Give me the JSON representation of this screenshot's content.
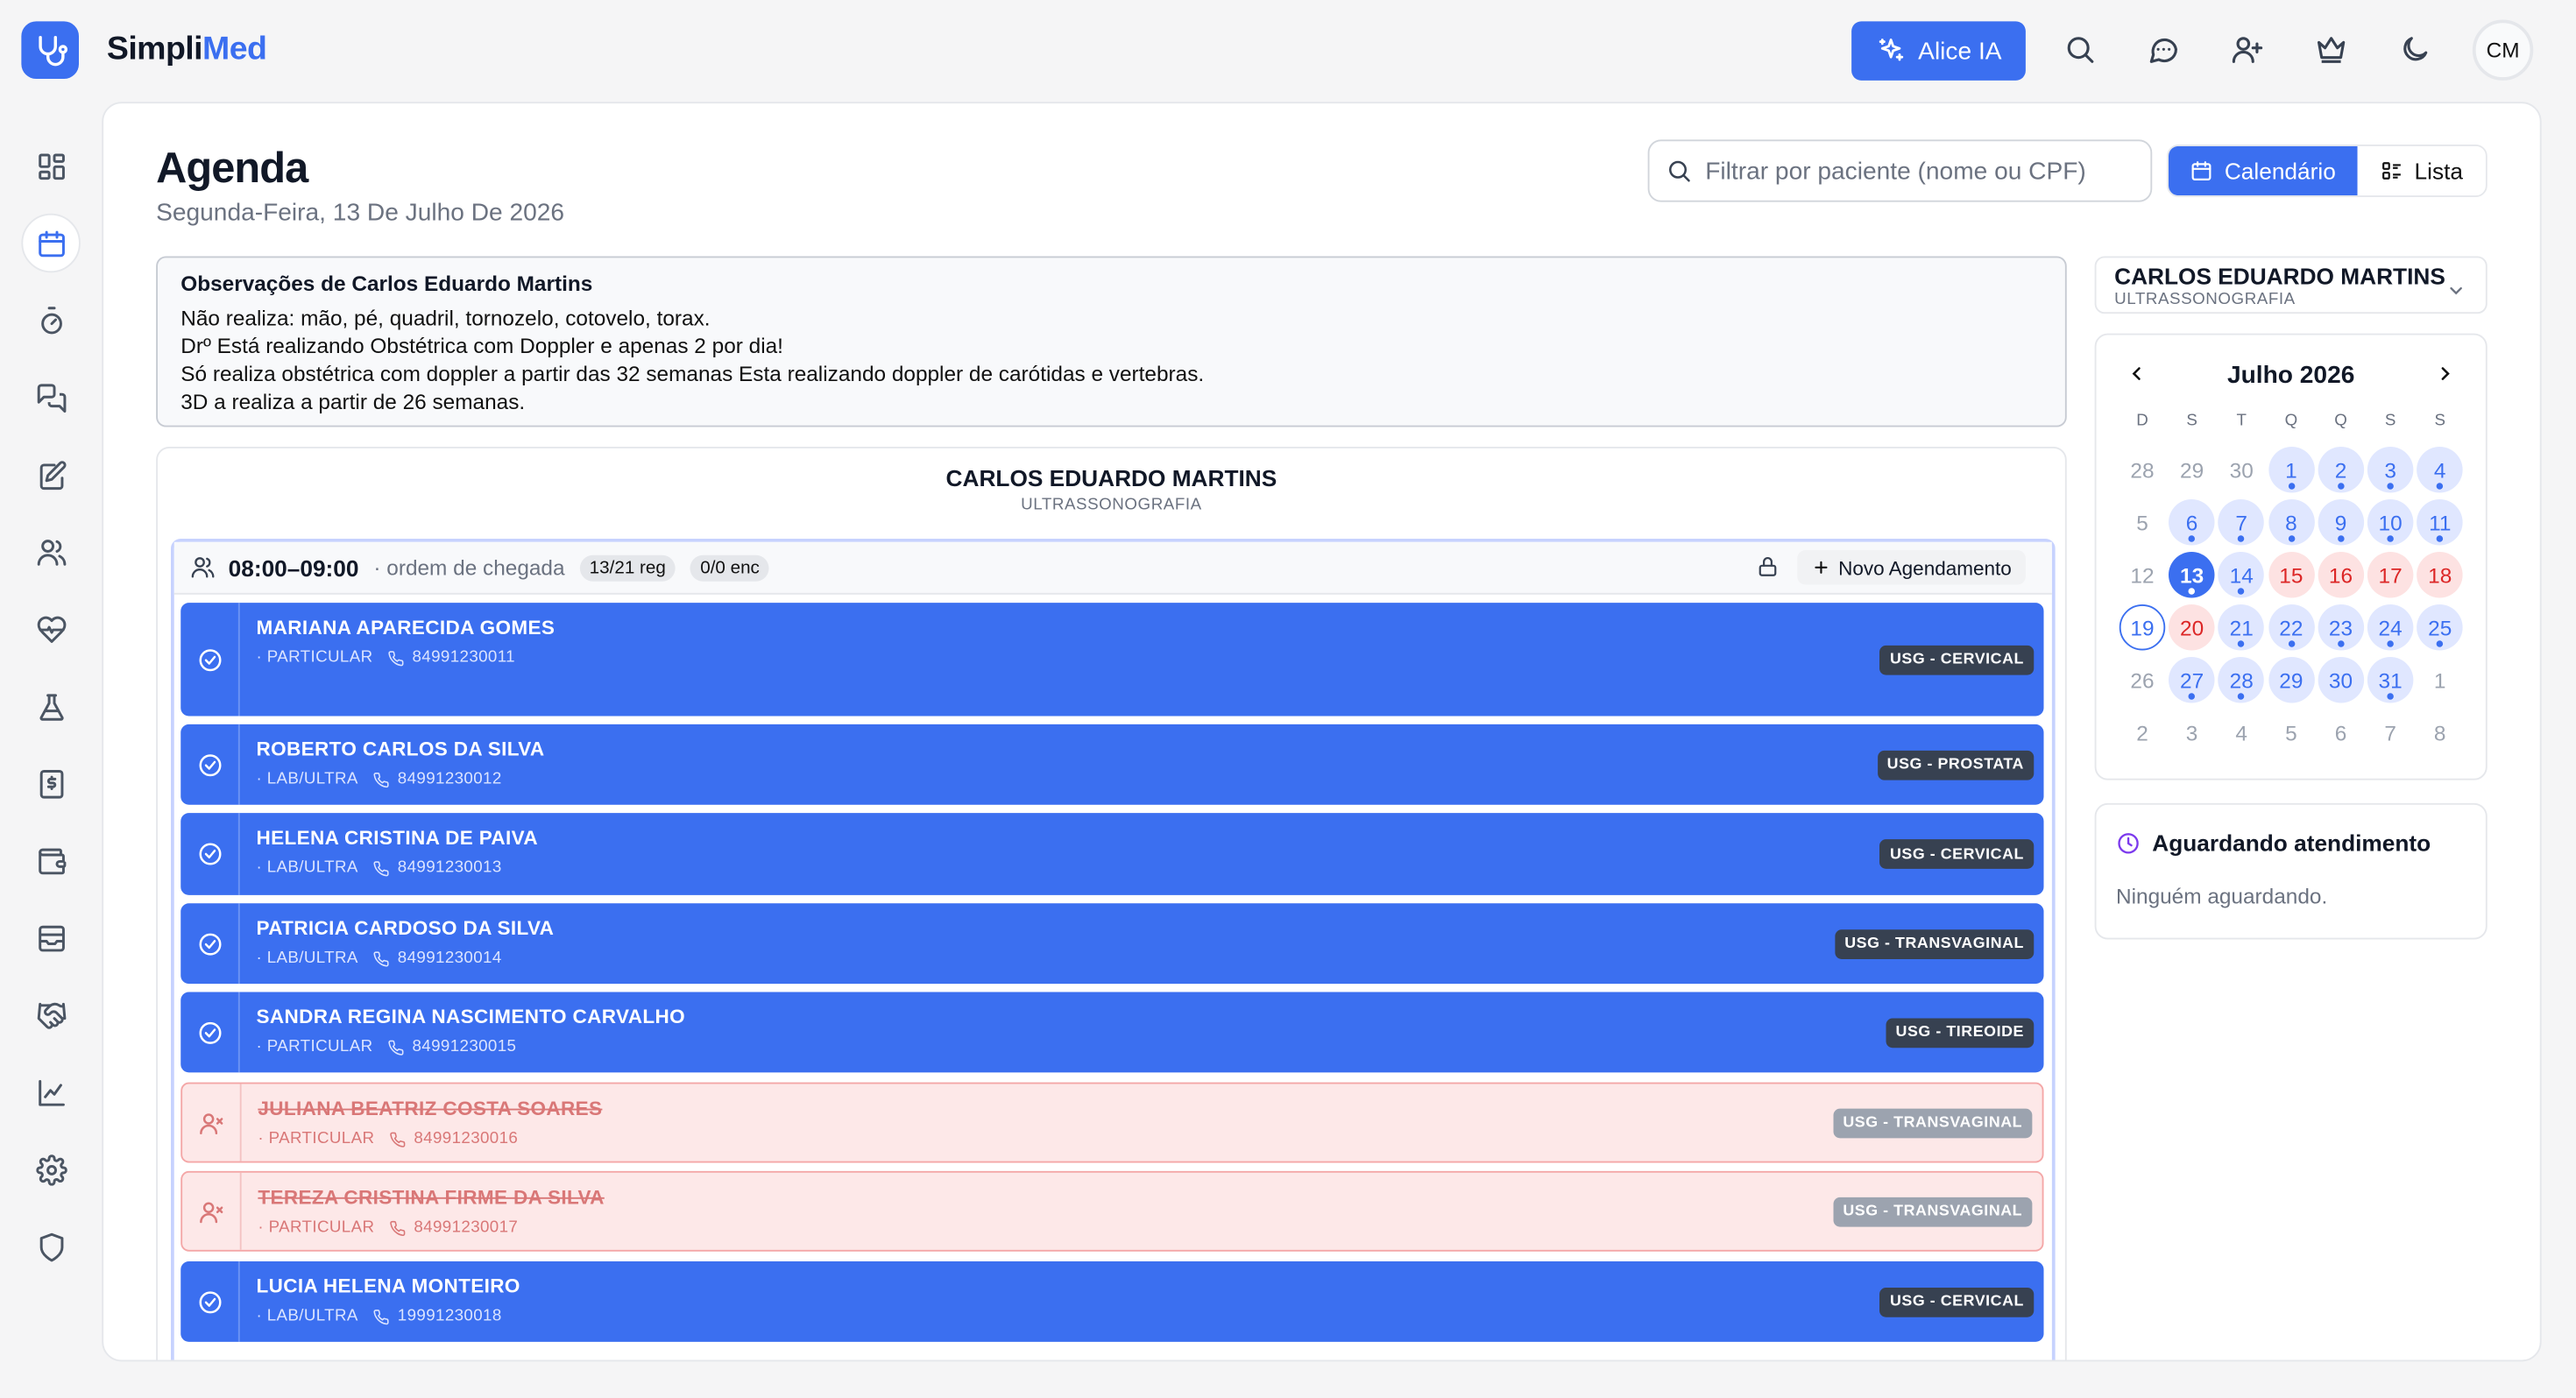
{
  "brand": {
    "name_a": "Simpli",
    "name_b": "Med",
    "accent": "#3b6ff0"
  },
  "topbar": {
    "alice_label": "Alice IA",
    "avatar_initials": "CM"
  },
  "page": {
    "title": "Agenda",
    "subtitle": "Segunda-Feira, 13 De Julho De 2026"
  },
  "filter": {
    "placeholder": "Filtrar por paciente (nome ou CPF)"
  },
  "view_toggle": {
    "calendar_label": "Calendário",
    "list_label": "Lista"
  },
  "observations": {
    "title": "Observações de Carlos Eduardo Martins",
    "lines": [
      "Não realiza: mão, pé, quadril, tornozelo, cotovelo, torax.",
      "Drº Está realizando Obstétrica com Doppler e apenas 2 por dia!",
      "Só realiza obstétrica com doppler a partir das 32 semanas Esta realizando doppler de carótidas e vertebras.",
      "3D a realiza a partir de 26 semanas."
    ]
  },
  "schedule": {
    "doctor": "CARLOS EDUARDO MARTINS",
    "specialty": "ULTRASSONOGRAFIA",
    "slot_time": "08:00–09:00",
    "slot_mode": "· ordem de chegada",
    "chip_reg": "13/21 reg",
    "chip_enc": "0/0 enc",
    "new_button": "Novo Agendamento",
    "appointments": [
      {
        "name": "MARIANA APARECIDA GOMES",
        "insurance": "· PARTICULAR",
        "phone": "84991230011",
        "exam": "USG - CERVICAL",
        "status": "confirmed"
      },
      {
        "name": "ROBERTO CARLOS DA SILVA",
        "insurance": "· LAB/ULTRA",
        "phone": "84991230012",
        "exam": "USG - PROSTATA",
        "status": "confirmed"
      },
      {
        "name": "HELENA CRISTINA DE PAIVA",
        "insurance": "· LAB/ULTRA",
        "phone": "84991230013",
        "exam": "USG - CERVICAL",
        "status": "confirmed"
      },
      {
        "name": "PATRICIA CARDOSO DA SILVA",
        "insurance": "· LAB/ULTRA",
        "phone": "84991230014",
        "exam": "USG - TRANSVAGINAL",
        "status": "confirmed"
      },
      {
        "name": "SANDRA REGINA NASCIMENTO CARVALHO",
        "insurance": "· PARTICULAR",
        "phone": "84991230015",
        "exam": "USG - TIREOIDE",
        "status": "confirmed"
      },
      {
        "name": "JULIANA BEATRIZ COSTA SOARES",
        "insurance": "· PARTICULAR",
        "phone": "84991230016",
        "exam": "USG - TRANSVAGINAL",
        "status": "cancelled"
      },
      {
        "name": "TEREZA CRISTINA FIRME DA SILVA",
        "insurance": "· PARTICULAR",
        "phone": "84991230017",
        "exam": "USG - TRANSVAGINAL",
        "status": "cancelled"
      },
      {
        "name": "LUCIA HELENA MONTEIRO",
        "insurance": "· LAB/ULTRA",
        "phone": "19991230018",
        "exam": "USG - CERVICAL",
        "status": "confirmed"
      }
    ]
  },
  "doctor_select": {
    "name": "CARLOS EDUARDO MARTINS",
    "specialty": "ULTRASSONOGRAFIA"
  },
  "calendar": {
    "month_label": "Julho 2026",
    "weekdays": [
      "D",
      "S",
      "T",
      "Q",
      "Q",
      "S",
      "S"
    ],
    "weeks": [
      [
        {
          "d": "28",
          "k": "out"
        },
        {
          "d": "29",
          "k": "out"
        },
        {
          "d": "30",
          "k": "out"
        },
        {
          "d": "1",
          "k": "book",
          "dot": true
        },
        {
          "d": "2",
          "k": "book",
          "dot": true
        },
        {
          "d": "3",
          "k": "book",
          "dot": true
        },
        {
          "d": "4",
          "k": "book",
          "dot": true
        }
      ],
      [
        {
          "d": "5",
          "k": "cur"
        },
        {
          "d": "6",
          "k": "book",
          "dot": true
        },
        {
          "d": "7",
          "k": "book",
          "dot": true
        },
        {
          "d": "8",
          "k": "book",
          "dot": true
        },
        {
          "d": "9",
          "k": "book",
          "dot": true
        },
        {
          "d": "10",
          "k": "book",
          "dot": true
        },
        {
          "d": "11",
          "k": "book",
          "dot": true
        }
      ],
      [
        {
          "d": "12",
          "k": "cur"
        },
        {
          "d": "13",
          "k": "today",
          "dot": true
        },
        {
          "d": "14",
          "k": "book",
          "dot": true
        },
        {
          "d": "15",
          "k": "red"
        },
        {
          "d": "16",
          "k": "red"
        },
        {
          "d": "17",
          "k": "red"
        },
        {
          "d": "18",
          "k": "red"
        }
      ],
      [
        {
          "d": "19",
          "k": "sel"
        },
        {
          "d": "20",
          "k": "red"
        },
        {
          "d": "21",
          "k": "book",
          "dot": true
        },
        {
          "d": "22",
          "k": "book",
          "dot": true
        },
        {
          "d": "23",
          "k": "book",
          "dot": true
        },
        {
          "d": "24",
          "k": "book",
          "dot": true
        },
        {
          "d": "25",
          "k": "book",
          "dot": true
        }
      ],
      [
        {
          "d": "26",
          "k": "cur"
        },
        {
          "d": "27",
          "k": "book",
          "dot": true
        },
        {
          "d": "28",
          "k": "book",
          "dot": true
        },
        {
          "d": "29",
          "k": "book"
        },
        {
          "d": "30",
          "k": "book"
        },
        {
          "d": "31",
          "k": "book",
          "dot": true
        },
        {
          "d": "1",
          "k": "out"
        }
      ],
      [
        {
          "d": "2",
          "k": "out"
        },
        {
          "d": "3",
          "k": "out"
        },
        {
          "d": "4",
          "k": "out"
        },
        {
          "d": "5",
          "k": "out"
        },
        {
          "d": "6",
          "k": "out"
        },
        {
          "d": "7",
          "k": "out"
        },
        {
          "d": "8",
          "k": "out"
        }
      ]
    ]
  },
  "waiting": {
    "title": "Aguardando atendimento",
    "empty": "Ninguém aguardando."
  }
}
